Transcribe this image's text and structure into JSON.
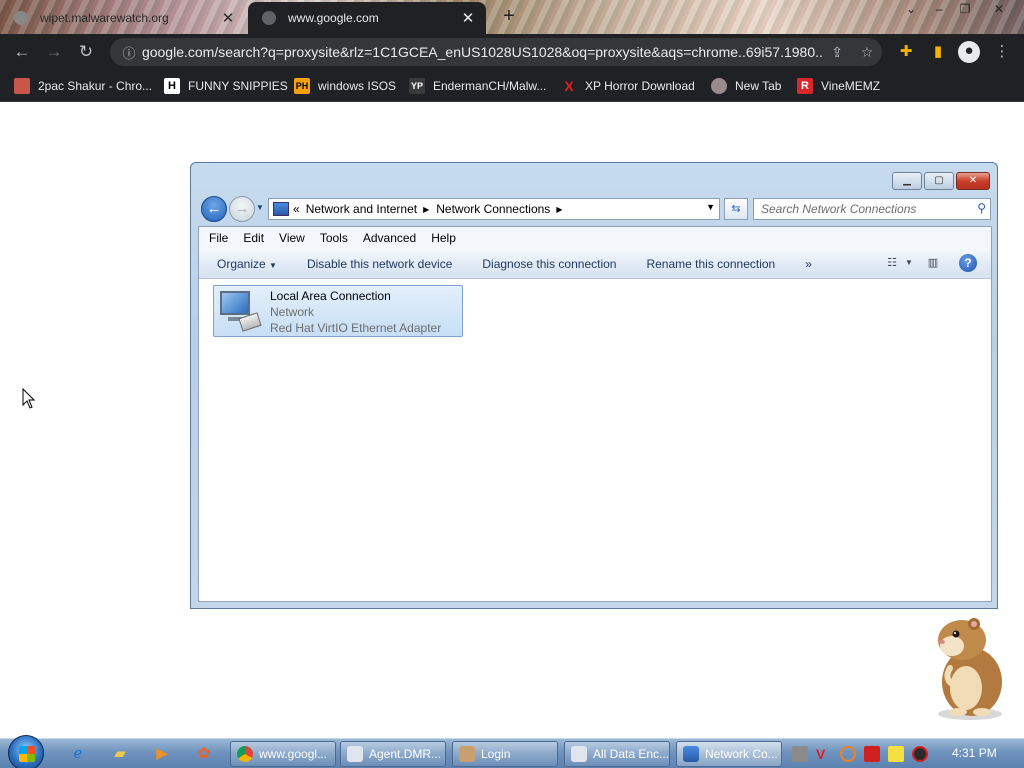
{
  "browser": {
    "tabs": [
      {
        "title": "wipet.malwarewatch.org",
        "active": false
      },
      {
        "title": "www.google.com",
        "active": true
      }
    ],
    "url": "google.com/search?q=proxysite&rlz=1C1GCEA_enUS1028US1028&oq=proxysite&aqs=chrome..69i57.1980...",
    "bookmarks": [
      {
        "label": "2pac Shakur - Chro...",
        "icon": "image-icon"
      },
      {
        "label": "FUNNY SNIPPIES",
        "icon": "h-logo-icon"
      },
      {
        "label": "windows ISOS",
        "icon": "ph-logo-icon"
      },
      {
        "label": "EndermanCH/Malw...",
        "icon": "youtube-premium-icon"
      },
      {
        "label": "XP Horror Download",
        "icon": "x-icon"
      },
      {
        "label": "New Tab",
        "icon": "globe-icon"
      },
      {
        "label": "VineMEMZ",
        "icon": "r-logo-icon"
      }
    ]
  },
  "explorer": {
    "breadcrumb": [
      "Network and Internet",
      "Network Connections"
    ],
    "breadcrumb_overflow": "«",
    "search_placeholder": "Search Network Connections",
    "menu": [
      "File",
      "Edit",
      "View",
      "Tools",
      "Advanced",
      "Help"
    ],
    "commands": {
      "organize": "Organize",
      "disable": "Disable this network device",
      "diagnose": "Diagnose this connection",
      "rename": "Rename this connection",
      "more": "»"
    },
    "connection": {
      "name": "Local Area Connection",
      "status": "Network",
      "adapter": "Red Hat VirtIO Ethernet Adapter"
    }
  },
  "taskbar": {
    "tasks": [
      {
        "label": "www.googl...",
        "icon": "chrome-icon",
        "active": false
      },
      {
        "label": "Agent.DMR...",
        "icon": "window-icon",
        "active": false
      },
      {
        "label": "Login",
        "icon": "app-icon",
        "active": false
      },
      {
        "label": "All Data Enc...",
        "icon": "window-icon",
        "active": false
      },
      {
        "label": "Network Co...",
        "icon": "network-folder-icon",
        "active": true
      }
    ],
    "clock": "4:31 PM"
  },
  "colors": {
    "chrome_dark": "#202124",
    "explorer_frame": "#c7dbee",
    "taskbar": "#6f93bd",
    "selection": "#c7def5"
  }
}
